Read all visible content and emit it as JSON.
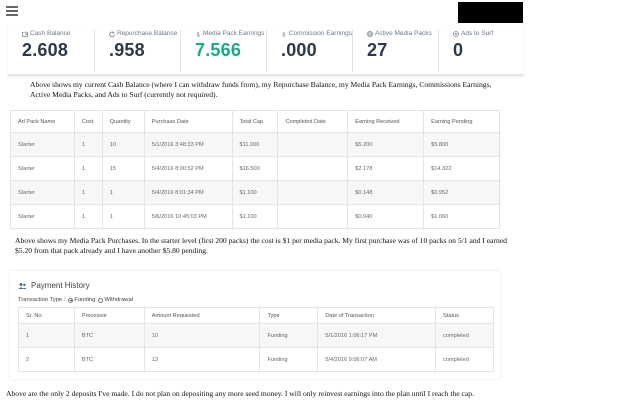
{
  "header": {
    "menu_icon": "hamburger-icon"
  },
  "stats": [
    {
      "label": "Cash Balance",
      "icon": "wallet-icon",
      "value": "2.608",
      "color": "#2b3a4a"
    },
    {
      "label": "Repurchase Balance",
      "icon": "refresh-icon",
      "value": ".958",
      "color": "#2b3a4a"
    },
    {
      "label": "Media Pack Earnings",
      "icon": "dollar-icon",
      "value": "7.566",
      "color": "#1aaa8a"
    },
    {
      "label": "Commission Earnings",
      "icon": "dollar-icon",
      "value": ".000",
      "color": "#2b3a4a"
    },
    {
      "label": "Active Media Packs",
      "icon": "globe-icon",
      "value": "27",
      "color": "#2b3a4a"
    },
    {
      "label": "Ads to Surf",
      "icon": "target-icon",
      "value": "0",
      "color": "#2b3a4a"
    }
  ],
  "notes": {
    "p1": "Above shows my current Cash Balance (where I can withdraw funds from), my Repurchase Balance, my Media Pack Earnings, Commissions Earnings, Active Media Packs, and Ads to Surf (currently not required).",
    "p2": "Above shows my Media Pack Purchases.  In the starter level (first 200 packs) the cost is $1 per media pack.  My first purchase was of 10 packs on 5/1 and I earned $5.20 from that pack already and I have another $5.80 pending.",
    "p3": "Above are the only 2 deposits I've made.  I do not plan on depositing any more seed money.  I will only reinvest earnings into the plan until I reach the cap."
  },
  "packs_table": {
    "headers": [
      "Ad Pack Name",
      "Cost",
      "Quantity",
      "Purchase Date",
      "Total Cap",
      "Completed Date",
      "Earning Received",
      "Earning Pending"
    ],
    "rows": [
      [
        "Starter",
        "1",
        "10",
        "5/1/2016 3:48:33 PM",
        "$11.000",
        "",
        "$5.200",
        "$5.800"
      ],
      [
        "Starter",
        "1",
        "15",
        "5/4/2016 8:00:52 PM",
        "$16.500",
        "",
        "$2.178",
        "$14.322"
      ],
      [
        "Starter",
        "1",
        "1",
        "5/4/2016 8:01:34 PM",
        "$1.100",
        "",
        "$0.148",
        "$0.952"
      ],
      [
        "Starter",
        "1",
        "1",
        "5/6/2016 10:45:03 PM",
        "$1.100",
        "",
        "$0.040",
        "$1.060"
      ]
    ]
  },
  "payment": {
    "title": "Payment History",
    "icon": "users-icon",
    "transaction_type_label": "Transaction Type :",
    "options": [
      {
        "label": "Funding",
        "checked": true
      },
      {
        "label": "Withdrawal",
        "checked": false
      }
    ],
    "headers": [
      "Sr. No.",
      "Processor",
      "Amount Requested",
      "Type",
      "Date of Transaction",
      "Status"
    ],
    "rows": [
      [
        "1",
        "BTC",
        "10",
        "Funding",
        "5/1/2016 1:06:17 PM",
        "completed"
      ],
      [
        "2",
        "BTC",
        "13",
        "Funding",
        "5/4/2016 9:06:07 AM",
        "completed"
      ]
    ]
  }
}
